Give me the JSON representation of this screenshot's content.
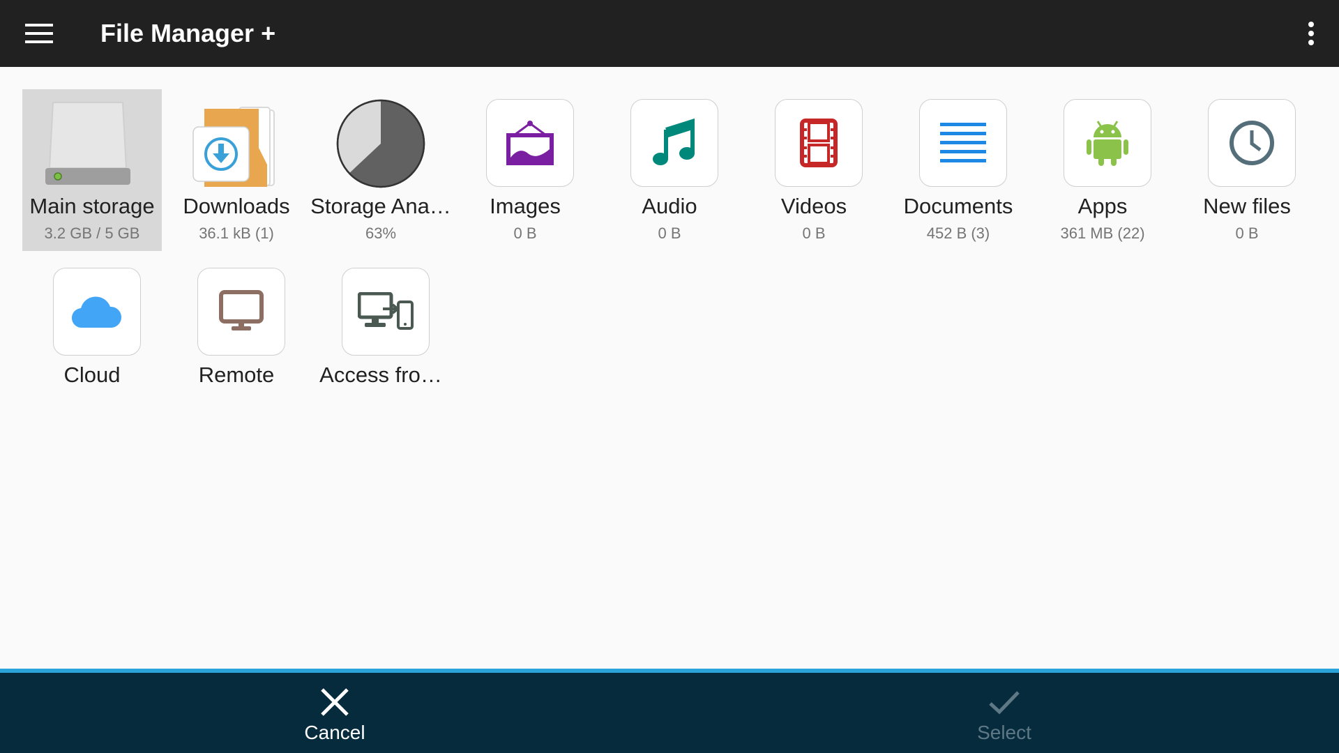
{
  "appbar": {
    "title": "File Manager +",
    "menu_icon": "hamburger-menu-icon",
    "overflow_icon": "more-vert-icon"
  },
  "colors": {
    "appbar_bg": "#212121",
    "bottom_bar_bg": "#052b3d",
    "bottom_accent": "#29a3d9",
    "images_icon": "#7b1fa2",
    "audio_icon": "#00897b",
    "videos_icon": "#c62828",
    "documents_icon": "#1e88e5",
    "apps_icon": "#8bc34a",
    "newfiles_icon": "#546e7a",
    "cloud_icon": "#42a5f5",
    "remote_icon": "#8d6e63",
    "access_icon": "#4a5a52"
  },
  "tiles": [
    {
      "label": "Main storage",
      "sub": "3.2 GB / 5 GB",
      "icon": "hard-drive-icon",
      "selected": true
    },
    {
      "label": "Downloads",
      "sub": "36.1 kB (1)",
      "icon": "downloads-folder-icon"
    },
    {
      "label": "Storage Ana…",
      "sub": "63%",
      "icon": "pie-chart-icon",
      "usage_fraction": 0.63
    },
    {
      "label": "Images",
      "sub": "0 B",
      "icon": "image-icon"
    },
    {
      "label": "Audio",
      "sub": "0 B",
      "icon": "music-note-icon"
    },
    {
      "label": "Videos",
      "sub": "0 B",
      "icon": "film-strip-icon"
    },
    {
      "label": "Documents",
      "sub": "452 B (3)",
      "icon": "document-lines-icon"
    },
    {
      "label": "Apps",
      "sub": "361 MB (22)",
      "icon": "android-icon"
    },
    {
      "label": "New files",
      "sub": "0 B",
      "icon": "clock-icon"
    },
    {
      "label": "Cloud",
      "icon": "cloud-icon"
    },
    {
      "label": "Remote",
      "icon": "monitor-icon"
    },
    {
      "label": "Access fro…",
      "icon": "devices-icon"
    }
  ],
  "bottom": {
    "cancel_label": "Cancel",
    "cancel_icon": "close-icon",
    "select_label": "Select",
    "select_icon": "check-icon",
    "select_enabled": false
  }
}
